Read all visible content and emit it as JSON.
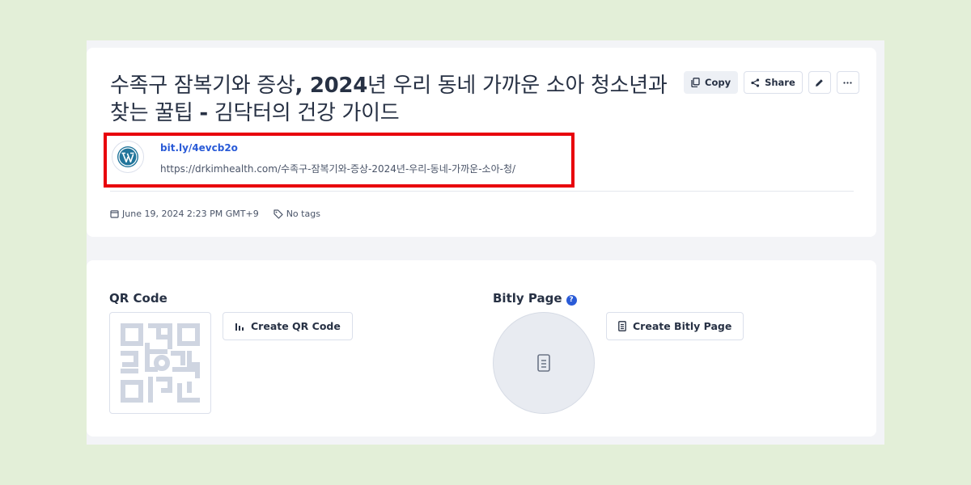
{
  "link": {
    "title_part1": "수족구 잠복기와 증상",
    "title_bold1": ", 2024",
    "title_part2": "년 우리 동네 가까운 소아 청소년과 찾는 꿀팁 ",
    "title_bold2": "-",
    "title_part3": " 김닥터의 건강 가이드",
    "short_url": "bit.ly/4evcb2o",
    "long_url": "https://drkimhealth.com/수족구-잠복기와-증상-2024년-우리-동네-가까운-소아-청/",
    "created": "June 19, 2024 2:23 PM GMT+9",
    "tags": "No tags"
  },
  "actions": {
    "copy_label": "Copy",
    "share_label": "Share"
  },
  "qr": {
    "title": "QR Code",
    "create_label": "Create QR Code"
  },
  "bitly_page": {
    "title": "Bitly Page",
    "help": "?",
    "create_label": "Create Bitly Page"
  },
  "colors": {
    "highlight": "#e8000b",
    "link": "#2a5bd7",
    "background": "#e3efd8"
  }
}
